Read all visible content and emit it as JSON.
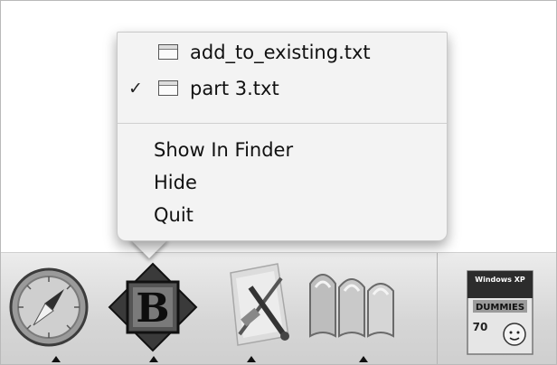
{
  "menu": {
    "windows": [
      {
        "label": "add_to_existing.txt",
        "checked": false,
        "icon": "document-window-icon"
      },
      {
        "label": "part 3.txt",
        "checked": true,
        "icon": "document-window-icon"
      }
    ],
    "check_mark": "✓",
    "actions": [
      {
        "label": "Show In Finder"
      },
      {
        "label": "Hide"
      },
      {
        "label": "Quit"
      }
    ]
  },
  "dock": {
    "apps": [
      {
        "icon": "safari-compass-icon",
        "running": true
      },
      {
        "icon": "bbedit-b-icon",
        "running": true
      },
      {
        "icon": "xcode-tools-icon",
        "running": true
      },
      {
        "icon": "microsoft-word-icon",
        "running": true
      }
    ],
    "documents": [
      {
        "icon": "book-cover-icon",
        "cover_lines": [
          "Windows XP",
          "DUMMIES",
          "70"
        ]
      }
    ]
  }
}
